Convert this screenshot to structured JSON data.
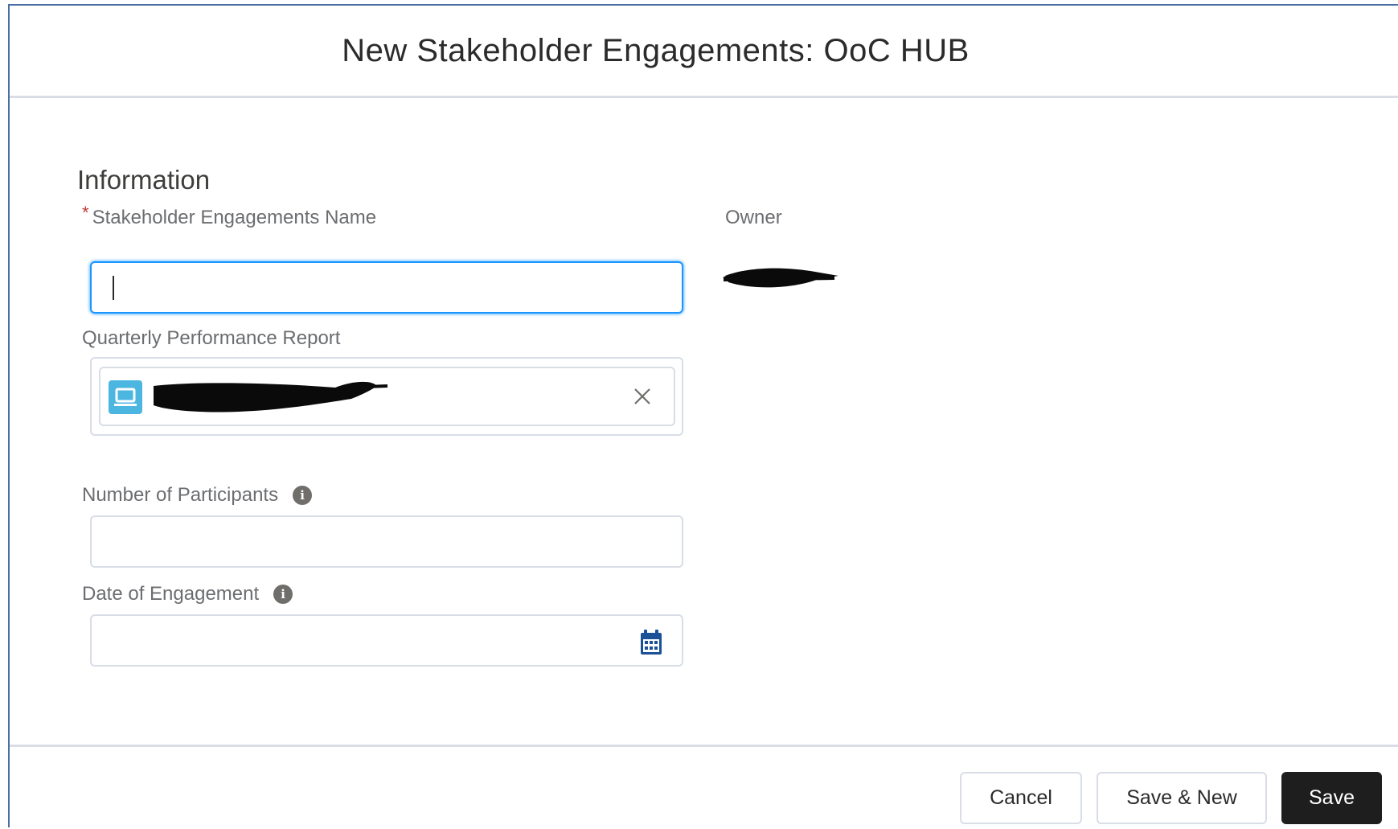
{
  "modal": {
    "title": "New Stakeholder Engagements: OoC HUB"
  },
  "section": {
    "title": "Information"
  },
  "fields": {
    "name": {
      "required_marker": "*",
      "label": "Stakeholder Engagements Name",
      "value": ""
    },
    "owner": {
      "label": "Owner"
    },
    "report": {
      "label": "Quarterly Performance Report",
      "record_icon": "computer-icon",
      "clear_icon": "close-icon"
    },
    "participants": {
      "label": "Number of Participants",
      "info_icon": "info-icon",
      "info_glyph": "i",
      "value": ""
    },
    "date": {
      "label": "Date of Engagement",
      "info_icon": "info-icon",
      "info_glyph": "i",
      "calendar_icon": "calendar-icon",
      "value": ""
    }
  },
  "footer": {
    "cancel_label": "Cancel",
    "save_new_label": "Save & New",
    "save_label": "Save"
  },
  "colors": {
    "brand_button": "#1e1e1e",
    "focus_border": "#1b96ff",
    "required": "#c23934",
    "record_icon_bg": "#4bb6e0",
    "calendar_icon": "#1b5297"
  }
}
